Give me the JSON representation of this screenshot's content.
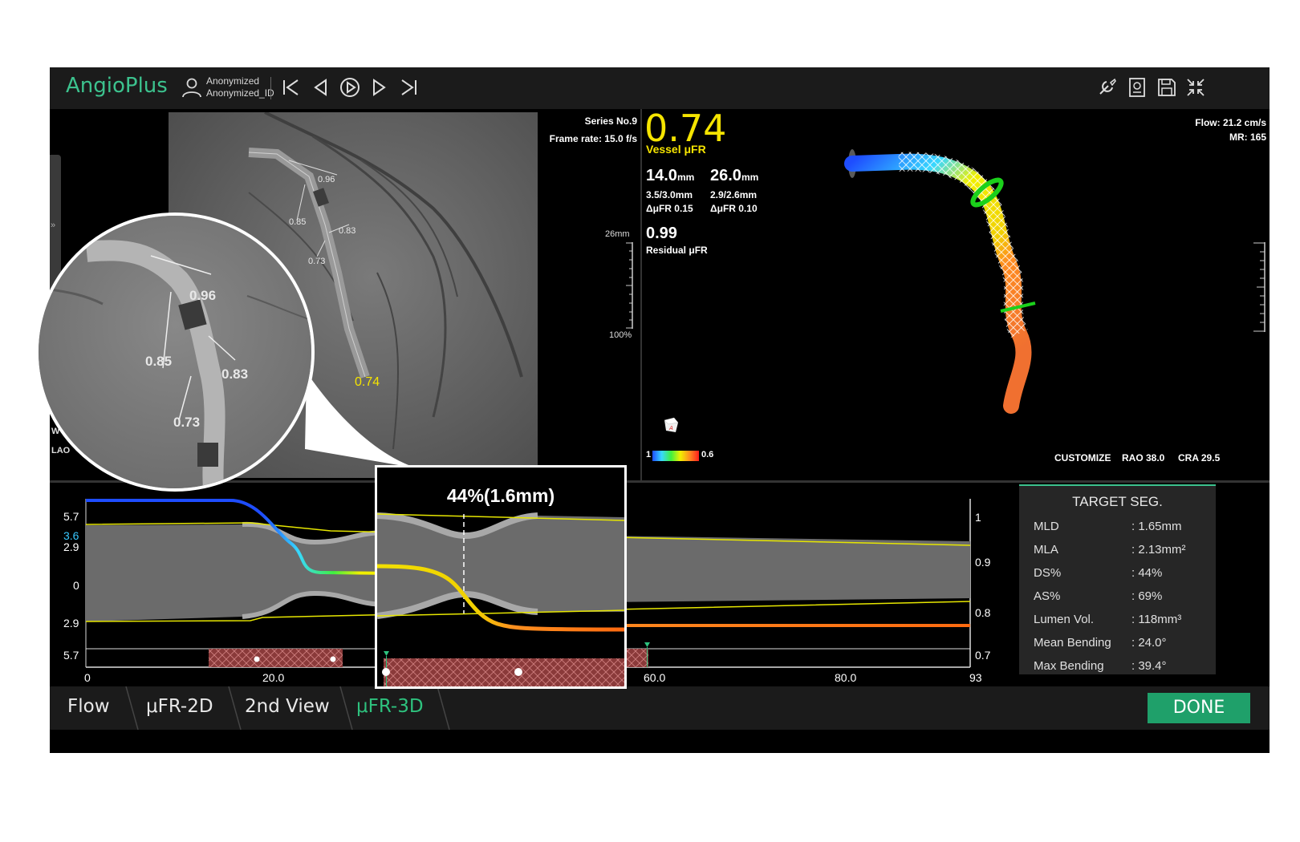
{
  "app": {
    "title": "AngioPlus"
  },
  "user": {
    "name": "Anonymized",
    "id": "Anonymized_ID"
  },
  "playback": [
    "first-frame",
    "previous-frame",
    "play",
    "next-frame",
    "last-frame"
  ],
  "toolbar_icons": [
    "wrench-icon",
    "report-icon",
    "save-icon",
    "collapse-icon"
  ],
  "angio": {
    "series": "Series No.9",
    "frame_rate": "Frame rate: 15.0 f/s",
    "branch_values": [
      "0.96",
      "0.85",
      "0.83",
      "0.73"
    ],
    "distal_value": "0.74",
    "view_label_1": "W",
    "view_label_2": "LAO"
  },
  "scale": {
    "top": "26mm",
    "bottom": "100%"
  },
  "vessel": {
    "ufr_value": "0.74",
    "ufr_label": "Vessel μFR",
    "seg1": {
      "length": "14.0",
      "unit": "mm",
      "diam": "3.5/3.0mm",
      "delta": "ΔμFR  0.15"
    },
    "seg2": {
      "length": "26.0",
      "unit": "mm",
      "diam": "2.9/2.6mm",
      "delta": "ΔμFR  0.10"
    },
    "residual_value": "0.99",
    "residual_label": "Residual μFR",
    "flow": "Flow: 21.2 cm/s",
    "mr": "MR: 165",
    "colorbar_min": "1",
    "colorbar_max": "0.6",
    "view_mode": "CUSTOMIZE",
    "rao": "RAO 38.0",
    "cra": "CRA 29.5"
  },
  "plot": {
    "y_left": [
      "5.7",
      "3.6",
      "2.9",
      "0",
      "2.9",
      "5.7"
    ],
    "y_right": [
      "1",
      "0.9",
      "0.8",
      "0.7"
    ],
    "x_ticks": [
      "0",
      "20.0",
      "60.0",
      "80.0",
      "93"
    ],
    "zoom_label": "44%(1.6mm)"
  },
  "stats": {
    "title": "TARGET SEG.",
    "rows": [
      {
        "label": "MLD",
        "value": ": 1.65mm"
      },
      {
        "label": "MLA",
        "value": ": 2.13mm²"
      },
      {
        "label": "DS%",
        "value": ": 44%"
      },
      {
        "label": "AS%",
        "value": ": 69%"
      },
      {
        "label": "Lumen Vol.",
        "value": ": 118mm³"
      },
      {
        "label": "Mean Bending",
        "value": ": 24.0°"
      },
      {
        "label": "Max Bending",
        "value": ": 39.4°"
      }
    ]
  },
  "tabs": [
    "Flow",
    "μFR-2D",
    "2nd View",
    "μFR-3D"
  ],
  "active_tab": "μFR-3D",
  "colors": {
    "accent": "#3cc28e",
    "done": "#1fa06a",
    "ufr": "#f5e400"
  },
  "done_label": "DONE"
}
